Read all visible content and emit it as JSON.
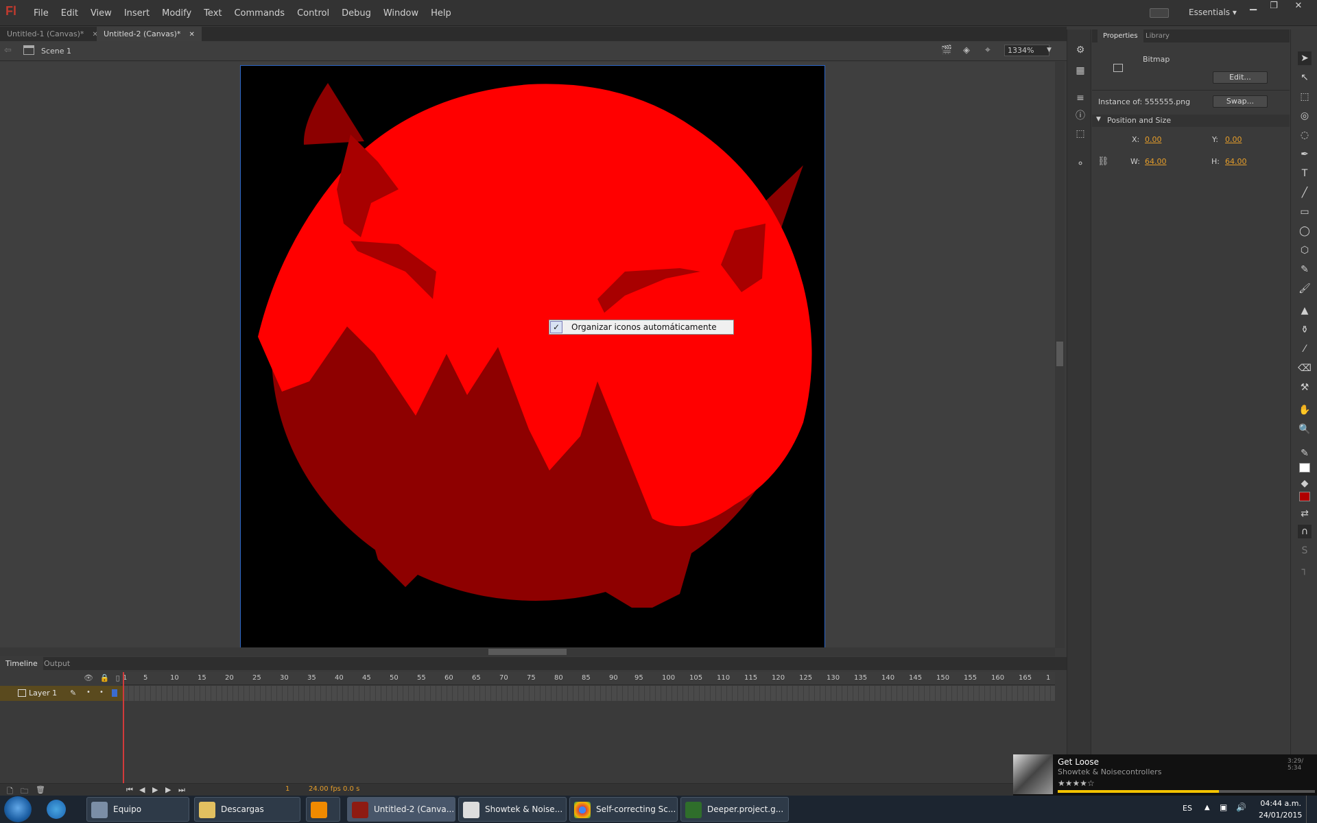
{
  "app": {
    "logo": "Fl"
  },
  "menu": [
    "File",
    "Edit",
    "View",
    "Insert",
    "Modify",
    "Text",
    "Commands",
    "Control",
    "Debug",
    "Window",
    "Help"
  ],
  "workspace": "Essentials",
  "doc_tabs": [
    {
      "label": "Untitled-1 (Canvas)*",
      "active": false
    },
    {
      "label": "Untitled-2 (Canvas)*",
      "active": true
    }
  ],
  "editbar": {
    "scene": "Scene 1",
    "zoom": "1334%"
  },
  "context_menu": {
    "item": "Organizar iconos automáticamente",
    "checked": true
  },
  "timeline": {
    "tabs": [
      "Timeline",
      "Output"
    ],
    "layer": "Layer 1",
    "ruler": [
      "1",
      "5",
      "10",
      "15",
      "20",
      "25",
      "30",
      "35",
      "40",
      "45",
      "50",
      "55",
      "60",
      "65",
      "70",
      "75",
      "80",
      "85",
      "90",
      "95",
      "100",
      "105",
      "110",
      "115",
      "120",
      "125",
      "130",
      "135",
      "140",
      "145",
      "150",
      "155",
      "160",
      "165",
      "1"
    ],
    "current_frame": "1",
    "fps": "24.00 fps",
    "time": "0.0 s"
  },
  "properties": {
    "tabs": [
      "Properties",
      "Library"
    ],
    "type": "Bitmap",
    "edit_btn": "Edit...",
    "instance_label": "Instance of:",
    "instance_value": "555555.png",
    "swap_btn": "Swap...",
    "section": "Position and Size",
    "x_label": "X:",
    "x": "0.00",
    "y_label": "Y:",
    "y": "0.00",
    "w_label": "W:",
    "w": "64.00",
    "h_label": "H:",
    "h": "64.00"
  },
  "media_player": {
    "title": "Get Loose",
    "artist": "Showtek & Noisecontrollers",
    "time": "3:29/ 5:34"
  },
  "taskbar": {
    "items": [
      {
        "label": "Equipo"
      },
      {
        "label": "Descargas"
      },
      {
        "label": ""
      },
      {
        "label": "Untitled-2 (Canva..."
      },
      {
        "label": "Showtek & Noise..."
      },
      {
        "label": "Self-correcting Sc..."
      },
      {
        "label": "Deeper.project.g..."
      }
    ],
    "lang": "ES",
    "clock_time": "04:44 a.m.",
    "clock_date": "24/01/2015"
  }
}
